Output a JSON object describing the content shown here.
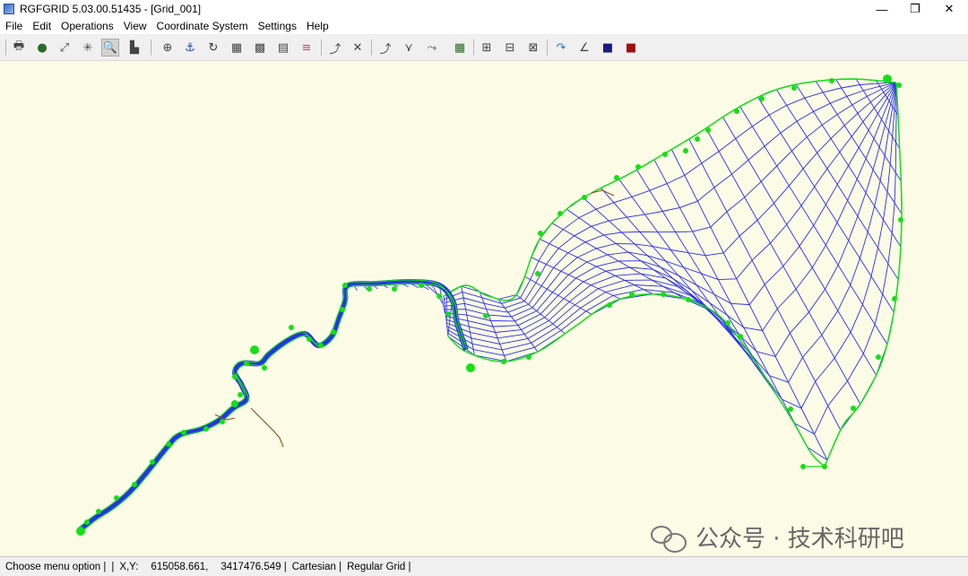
{
  "window": {
    "title": "RGFGRID 5.03.00.51435 - [Grid_001]",
    "controls": {
      "minimize": "—",
      "restore": "❐",
      "close": "✕"
    }
  },
  "menu": [
    "File",
    "Edit",
    "Operations",
    "View",
    "Coordinate System",
    "Settings",
    "Help"
  ],
  "toolbar": [
    {
      "name": "print-icon",
      "glyph": "🖶"
    },
    {
      "name": "globe-icon",
      "glyph": "●"
    },
    {
      "name": "zoom-extent-icon",
      "glyph": "⤢"
    },
    {
      "name": "zoom-to-center-icon",
      "glyph": "✳"
    },
    {
      "name": "zoom-box-icon",
      "glyph": "🔍",
      "pressed": true
    },
    {
      "name": "grid-legend-icon",
      "glyph": "▙"
    },
    {
      "name": "add-point-icon",
      "glyph": "⊕"
    },
    {
      "name": "anchor-icon",
      "glyph": "⚓"
    },
    {
      "name": "refresh-icon",
      "glyph": "↻"
    },
    {
      "name": "grid-select-icon",
      "glyph": "▦"
    },
    {
      "name": "grid-pattern-icon",
      "glyph": "▩"
    },
    {
      "name": "properties-icon",
      "glyph": "▤"
    },
    {
      "name": "colour-scale-icon",
      "glyph": "≡"
    },
    {
      "name": "spline-new-icon",
      "glyph": "⤴"
    },
    {
      "name": "spline-delete-icon",
      "glyph": "✕"
    },
    {
      "name": "spline-insert-icon",
      "glyph": "⤴"
    },
    {
      "name": "spline-merge-icon",
      "glyph": "⋎"
    },
    {
      "name": "spline-move-icon",
      "glyph": "⤳"
    },
    {
      "name": "grid-from-splines-icon",
      "glyph": "▦"
    },
    {
      "name": "grid-refine-icon",
      "glyph": "⊞"
    },
    {
      "name": "grid-derefine-icon",
      "glyph": "⊟"
    },
    {
      "name": "grid-point-icon",
      "glyph": "⊠"
    },
    {
      "name": "orthogonalise-icon",
      "glyph": "↷"
    },
    {
      "name": "measure-angle-icon",
      "glyph": "∠"
    },
    {
      "name": "land-boundary-icon",
      "glyph": "■"
    },
    {
      "name": "samples-icon",
      "glyph": "■"
    }
  ],
  "colors": {
    "grid": "#2b2ef0",
    "spline": "#14e014",
    "boundary": "#8b4a1a",
    "canvas": "#fbfbe6"
  },
  "watermark": {
    "text": "公众号 · 技术科研吧"
  },
  "status": {
    "hint": "Choose menu option |",
    "sep": "|",
    "xy_label": "X,Y:",
    "x": "615058.661,",
    "y": "3417476.549 |",
    "coord_system": "Cartesian |",
    "grid_type": "Regular Grid |"
  }
}
